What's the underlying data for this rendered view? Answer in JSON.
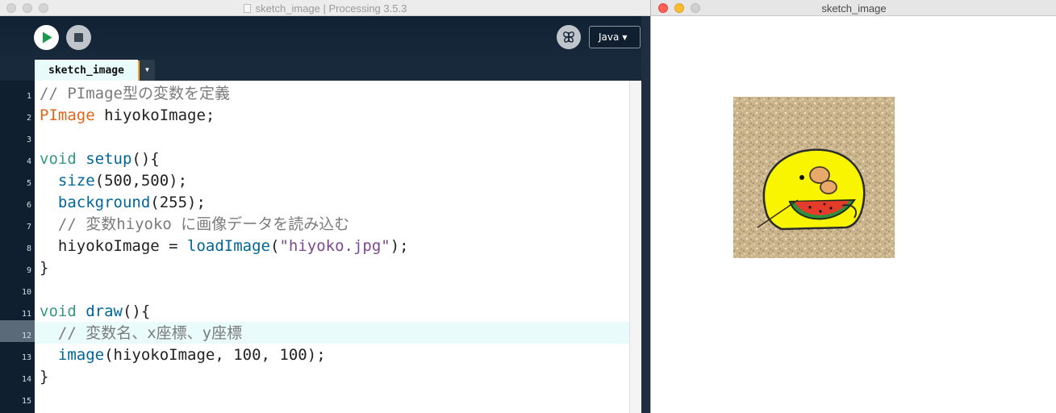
{
  "ide": {
    "window_title": "sketch_image | Processing 3.5.3",
    "toolbar": {
      "run_icon": "play-icon",
      "stop_icon": "stop-icon",
      "debug_icon": "butterfly-debug-icon",
      "mode_label": "Java",
      "mode_caret": "▼"
    },
    "tab": {
      "label": "sketch_image",
      "menu_glyph": "▼"
    },
    "editor": {
      "current_line": 12,
      "line_numbers": [
        "1",
        "2",
        "3",
        "4",
        "5",
        "6",
        "7",
        "8",
        "9",
        "10",
        "11",
        "12",
        "13",
        "14",
        "15"
      ],
      "lines": {
        "l1_comment": "// PImage型の変数を定義",
        "l2_type": "PImage",
        "l2_rest": " hiyokoImage;",
        "l4_void": "void",
        "l4_sp": " ",
        "l4_fn": "setup",
        "l4_rest": "(){",
        "l5_indent": "  ",
        "l5_fn": "size",
        "l5_rest": "(500,500);",
        "l6_indent": "  ",
        "l6_fn": "background",
        "l6_rest": "(255);",
        "l7_comment": "  // 変数hiyoko に画像データを読み込む",
        "l8_a": "  hiyokoImage = ",
        "l8_fn": "loadImage",
        "l8_open": "(",
        "l8_str": "\"hiyoko.jpg\"",
        "l8_close": ");",
        "l9": "}",
        "l11_void": "void",
        "l11_sp": " ",
        "l11_fn": "draw",
        "l11_rest": "(){",
        "l12_comment": "  // 変数名、x座標、y座標",
        "l13_indent": "  ",
        "l13_fn": "image",
        "l13_rest": "(hiyokoImage, 100, 100);",
        "l14": "}"
      }
    }
  },
  "sketch_window": {
    "title": "sketch_image",
    "canvas_background": "#ffffff",
    "image": {
      "subject": "yellow-chick-eating-watermelon-on-sand-image"
    }
  },
  "colors": {
    "close": "#fe5f57",
    "minimize": "#febc2e",
    "zoom": "#28c840",
    "comment": "#7b7b7b",
    "type": "#e2661a",
    "keyword": "#33997e",
    "function": "#006699",
    "string": "#7d4793",
    "current_line": "#e9fbfb",
    "tab_accent": "#f5a623"
  }
}
